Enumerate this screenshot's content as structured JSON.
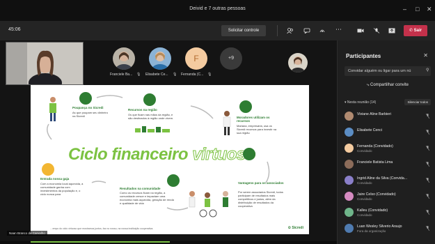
{
  "window": {
    "title": "Deivid e 7 outras pessoas"
  },
  "meeting": {
    "timer": "45:06",
    "request_control_label": "Solicitar controle",
    "leave_label": "Sair"
  },
  "stage": {
    "presenter_label": "Naan Branco de Carvalho",
    "participants": [
      {
        "label": "Franciele Ba..."
      },
      {
        "label": "Elisabete Ce..."
      },
      {
        "label": "Fernanda (C...",
        "initial": "F"
      }
    ],
    "more_count": "+9"
  },
  "slide": {
    "title_part1": "Ciclo financeiro",
    "title_part2": "virtuoso",
    "steps": [
      {
        "heading": "Poupança no Sicredi",
        "text": "As que poupam seu dinheiro na Sicredi"
      },
      {
        "heading": "Recursos na região",
        "text": "Os que ficam nas mãos da região, e são destinados à região onde vivem."
      },
      {
        "heading": "Moradores utilizam os recursos",
        "text": "Mariana, empresária, usa os Sicredi recursos para investir na sua região"
      },
      {
        "heading": "Vantagens para os associados",
        "text": "Por serem associados Sicredi, todos participam de resultados mais competitivos e justos, além da distribuição de resultados da cooperativa"
      },
      {
        "heading": "Resultados na comunidade",
        "text": "Como os recursos ficam na região, a comunidade cresce e impactam uma economia mais aquecida, geração de renda e qualidade de vida"
      },
      {
        "heading": "Entrada nossa gaja",
        "text": "Com a economia local aquecida, a comunidade ganha com investimentos da população e, o ciclo nunca para"
      }
    ],
    "footnote": "…empo do ciclo virtuoso que mostramos juntos, faz no nosso, na nossa instituição cooperativa.",
    "brand": "Sicredi"
  },
  "panel": {
    "title": "Participantes",
    "invite_placeholder": "Convidar alguém ou ligar para um nú",
    "share_invite_label": "Compartilhar convite",
    "section_label": "Nesta reunião (14)",
    "mute_all_label": "Silenciar todos",
    "people": [
      {
        "name": "Viviane Aline Barbieri",
        "sub": ""
      },
      {
        "name": "Elisabete Cenci",
        "sub": ""
      },
      {
        "name": "Fernanda (Convidado)",
        "sub": "Convidado"
      },
      {
        "name": "Franciele Batista Lima",
        "sub": ""
      },
      {
        "name": "Ingrid Aline da Silva (Convida...",
        "sub": "Convidado"
      },
      {
        "name": "Jaire Celso (Convidado)",
        "sub": "Convidado"
      },
      {
        "name": "Kalleu (Convidado)",
        "sub": "Convidado"
      },
      {
        "name": "Luan Wesley Silverio Araujo",
        "sub": "Fora da organização"
      }
    ]
  },
  "colors": {
    "accent": "#7cc242",
    "dark_green": "#2e7d32",
    "leave": "#c4314b"
  }
}
